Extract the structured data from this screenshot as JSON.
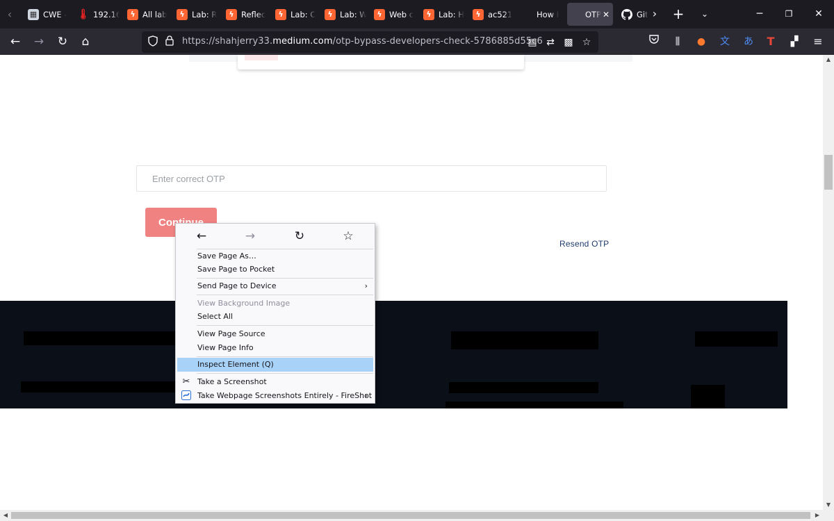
{
  "browser": {
    "tabs": [
      {
        "label": "CWE -",
        "favicon": "cwe-icon"
      },
      {
        "label": "192.16",
        "favicon": "thermometer-icon"
      },
      {
        "label": "All lab",
        "favicon": "portswigger-icon"
      },
      {
        "label": "Lab: R",
        "favicon": "portswigger-icon"
      },
      {
        "label": "Reflec",
        "favicon": "portswigger-icon"
      },
      {
        "label": "Lab: C",
        "favicon": "portswigger-icon"
      },
      {
        "label": "Lab: W",
        "favicon": "portswigger-icon"
      },
      {
        "label": "Web c",
        "favicon": "portswigger-icon"
      },
      {
        "label": "Lab: H",
        "favicon": "portswigger-icon"
      },
      {
        "label": "ac521",
        "favicon": "portswigger-icon"
      },
      {
        "label": "How I",
        "favicon": ""
      },
      {
        "label": "OTP",
        "favicon": "",
        "active": true
      },
      {
        "label": "Git",
        "favicon": "github-icon"
      }
    ],
    "url": {
      "prefix": "https://shahjerry33.",
      "host": "medium.com",
      "path": "/otp-bypass-developers-check-5786885d55c6"
    }
  },
  "page": {
    "otp_placeholder": "Enter correct OTP",
    "continue_label": "Continue",
    "resend_label": "Resend OTP"
  },
  "context_menu": {
    "items": [
      {
        "label": "Save Page As…",
        "has_submenu": false
      },
      {
        "label": "Save Page to Pocket",
        "has_submenu": false
      },
      {
        "label": "Send Page to Device",
        "has_submenu": true
      },
      {
        "label": "View Background Image",
        "disabled": true
      },
      {
        "label": "Select All"
      },
      {
        "label": "View Page Source"
      },
      {
        "label": "View Page Info"
      },
      {
        "label": "Inspect Element (Q)",
        "highlighted": true
      },
      {
        "label": "Take a Screenshot",
        "icon": "screenshot-icon"
      },
      {
        "label": "Take Webpage Screenshots Entirely - FireShot",
        "icon": "fireshot-icon",
        "has_submenu": true
      }
    ]
  },
  "colors": {
    "tab_strip_bg": "#1c1b22",
    "nav_bg": "#2b2a33",
    "continue_bg": "#f08282",
    "resend_text": "#1f3a6e",
    "footer_bg": "#0b0f18",
    "menu_highlight": "#a8d2f8",
    "portswigger_orange": "#ff6633"
  }
}
